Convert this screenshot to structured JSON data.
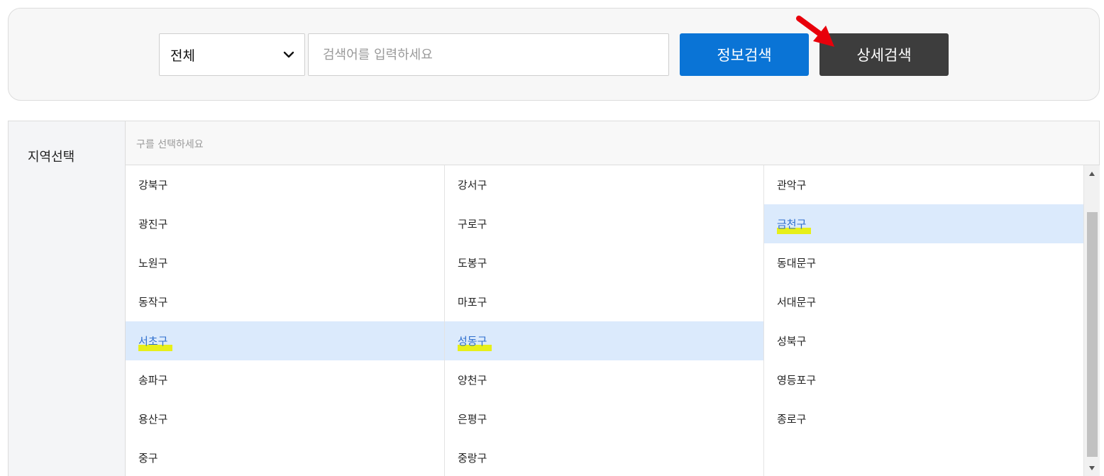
{
  "search": {
    "category_selected": "전체",
    "placeholder": "검색어를 입력하세요",
    "value": "",
    "info_button": "정보검색",
    "detail_button": "상세검색"
  },
  "region": {
    "label": "지역선택",
    "hint": "구를 선택하세요",
    "rows": [
      [
        {
          "name": "강북구",
          "selected": false
        },
        {
          "name": "강서구",
          "selected": false
        },
        {
          "name": "관악구",
          "selected": false
        }
      ],
      [
        {
          "name": "광진구",
          "selected": false
        },
        {
          "name": "구로구",
          "selected": false
        },
        {
          "name": "금천구",
          "selected": true
        }
      ],
      [
        {
          "name": "노원구",
          "selected": false
        },
        {
          "name": "도봉구",
          "selected": false
        },
        {
          "name": "동대문구",
          "selected": false
        }
      ],
      [
        {
          "name": "동작구",
          "selected": false
        },
        {
          "name": "마포구",
          "selected": false
        },
        {
          "name": "서대문구",
          "selected": false
        }
      ],
      [
        {
          "name": "서초구",
          "selected": true
        },
        {
          "name": "성동구",
          "selected": true
        },
        {
          "name": "성북구",
          "selected": false
        }
      ],
      [
        {
          "name": "송파구",
          "selected": false
        },
        {
          "name": "양천구",
          "selected": false
        },
        {
          "name": "영등포구",
          "selected": false
        }
      ],
      [
        {
          "name": "용산구",
          "selected": false
        },
        {
          "name": "은평구",
          "selected": false
        },
        {
          "name": "종로구",
          "selected": false
        }
      ],
      [
        {
          "name": "중구",
          "selected": false
        },
        {
          "name": "중랑구",
          "selected": false
        },
        {
          "name": "",
          "selected": false
        }
      ]
    ]
  },
  "colors": {
    "info_button": "#0a74d6",
    "detail_button": "#3d3d3d",
    "selected_bg": "#dbeafc",
    "selected_text": "#2f6fce",
    "highlight": "#e8f000",
    "arrow": "#e8000b"
  },
  "icons": {
    "select_chevron": "chevron-down-icon",
    "annotation_arrow": "red-arrow-icon",
    "scroll_up": "scroll-up-arrow-icon",
    "scroll_down": "scroll-down-arrow-icon"
  }
}
